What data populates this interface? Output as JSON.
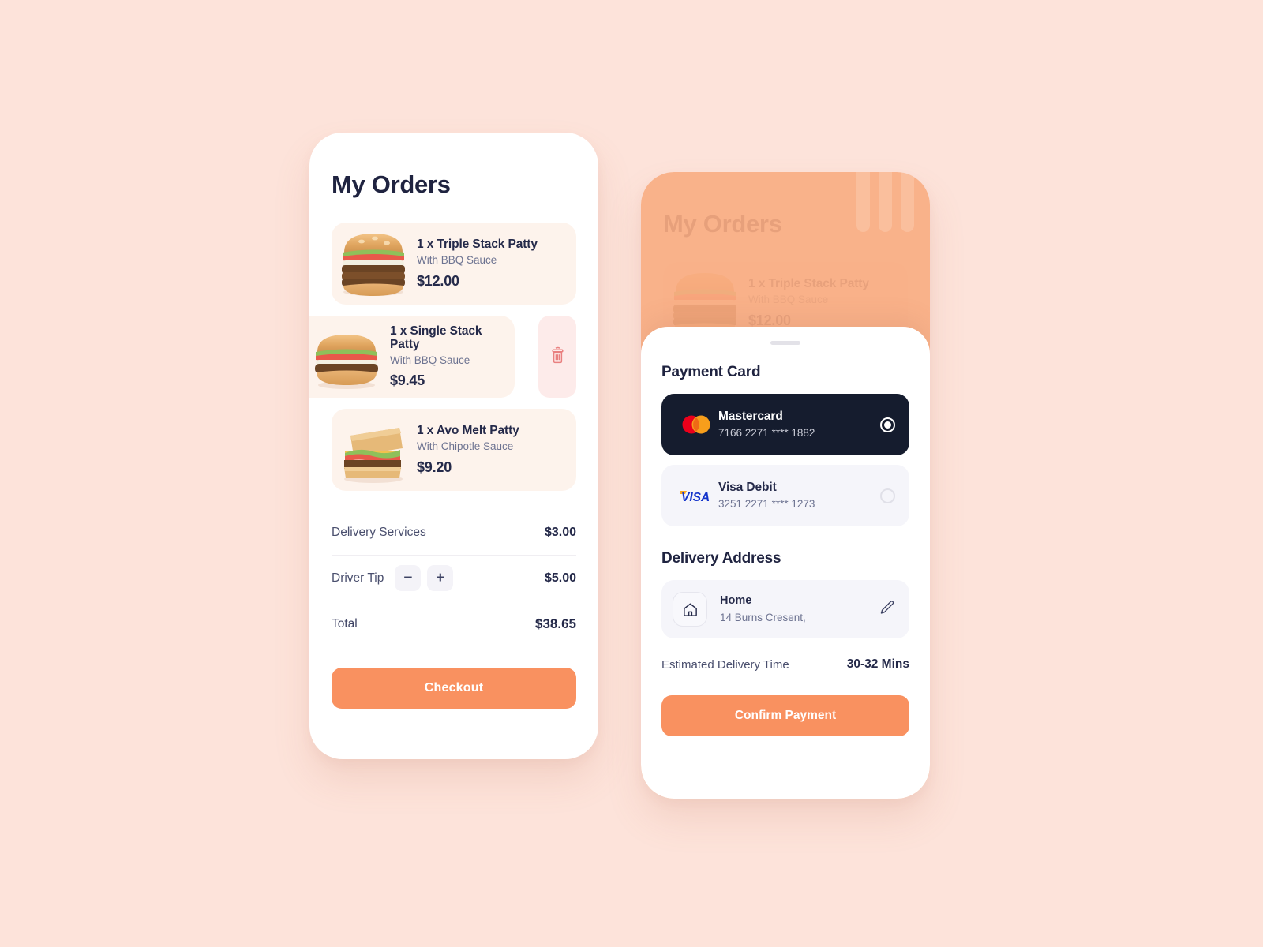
{
  "theme": {
    "page_background": "#FDE3DA",
    "accent_orange": "#F99160",
    "card_cream": "#FDF3EC",
    "dark_navy": "#151C2E",
    "text_navy": "#252A4A",
    "muted_text": "#6D7391",
    "delete_pink_bg": "#FDEBEA",
    "delete_pink_icon": "#E98080",
    "overlay_tint": "#F9AB80"
  },
  "orders_screen": {
    "title": "My Orders",
    "items": [
      {
        "name": "1 x Triple Stack Patty",
        "sauce": "With BBQ Sauce",
        "price": "$12.00",
        "image": "triple-stack-burger",
        "swiped": false
      },
      {
        "name": "1 x Single Stack Patty",
        "sauce": "With BBQ Sauce",
        "price": "$9.45",
        "image": "single-stack-burger",
        "swiped": true,
        "delete_icon": "trash-icon"
      },
      {
        "name": "1 x Avo Melt Patty",
        "sauce": "With Chipotle Sauce",
        "price": "$9.20",
        "image": "avo-melt-sandwich",
        "swiped": false
      }
    ],
    "summary": [
      {
        "label": "Delivery Services",
        "value": "$3.00"
      },
      {
        "label": "Driver Tip",
        "value": "$5.00",
        "decrement": "−",
        "increment": "+"
      },
      {
        "label": "Total",
        "value": "$38.65"
      }
    ],
    "checkout_label": "Checkout"
  },
  "payment_screen": {
    "background_title": "My Orders",
    "background_item": {
      "name": "1 x Triple Stack Patty",
      "sauce": "With BBQ Sauce",
      "price": "$12.00",
      "image": "triple-stack-burger"
    },
    "sheet": {
      "payment_heading": "Payment Card",
      "cards": [
        {
          "brand": "Mastercard",
          "number": "7166 2271 **** 1882",
          "logo": "mastercard-logo",
          "selected": true
        },
        {
          "brand": "Visa Debit",
          "number": "3251 2271 **** 1273",
          "logo": "visa-logo",
          "selected": false
        }
      ],
      "address_heading": "Delivery Address",
      "address": {
        "label": "Home",
        "line": "14 Burns Cresent,",
        "icon": "home-icon",
        "edit_icon": "pencil-edit-icon"
      },
      "eta_label": "Estimated Delivery Time",
      "eta_value": "30-32 Mins",
      "confirm_label": "Confirm Payment"
    }
  }
}
